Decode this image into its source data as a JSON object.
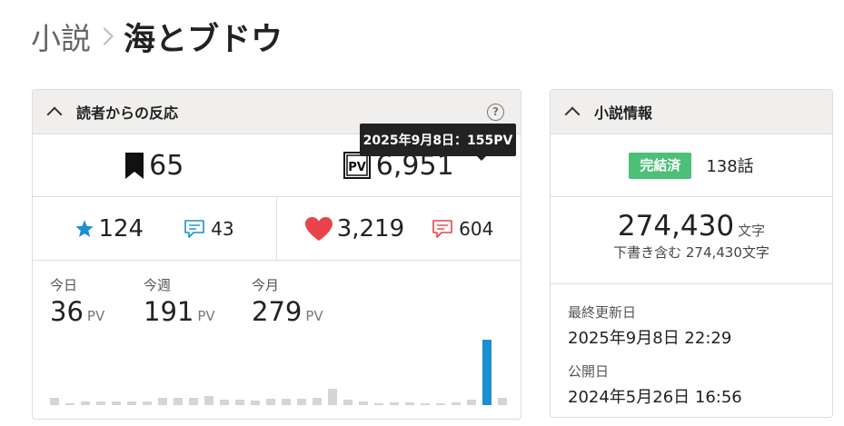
{
  "breadcrumb": {
    "parent": "小説",
    "title": "海とブドウ"
  },
  "reactions": {
    "header": "読者からの反応",
    "bookmarks": "65",
    "pv_total": "6,951",
    "stars": "124",
    "reviews": "43",
    "likes": "3,219",
    "comments": "604",
    "today_label": "今日",
    "today_value": "36",
    "week_label": "今週",
    "week_value": "191",
    "month_label": "今月",
    "month_value": "279",
    "unit": "PV",
    "tooltip": "2025年9月8日：155PV",
    "colors": {
      "star": "#1a8fd2",
      "heart": "#e8434a",
      "highlight_bar": "#1a8fd2",
      "bar": "#d5d5d5"
    }
  },
  "chart_data": {
    "type": "bar",
    "series": [
      {
        "values": [
          18,
          3,
          9,
          8,
          9,
          8,
          9,
          17,
          17,
          18,
          21,
          12,
          12,
          10,
          14,
          14,
          15,
          18,
          38,
          12,
          9,
          5,
          6,
          6,
          3,
          5,
          6,
          13,
          155,
          17
        ]
      }
    ],
    "highlight": {
      "index": 28,
      "label": "2025年9月8日：155PV"
    },
    "ylim": [
      0,
      155
    ]
  },
  "info": {
    "header": "小説情報",
    "status_badge": "完結済",
    "episodes": "138話",
    "chars": "274,430",
    "chars_unit": "文字",
    "chars_sub": "下書き含む 274,430文字",
    "updated_label": "最終更新日",
    "updated_value": "2025年9月8日 22:29",
    "published_label": "公開日",
    "published_value": "2024年5月26日 16:56",
    "colors": {
      "badge": "#4cbf78"
    }
  }
}
